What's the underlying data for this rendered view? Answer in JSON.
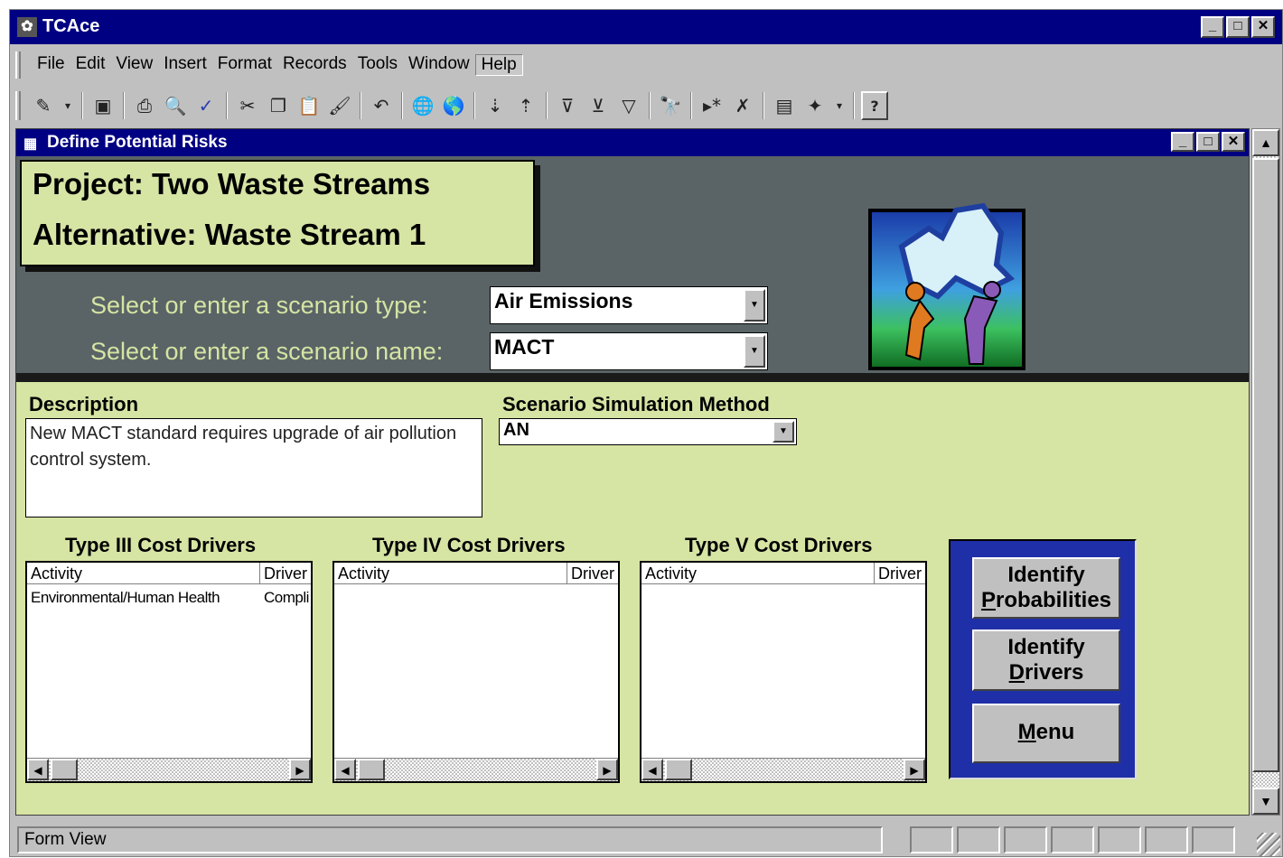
{
  "app": {
    "title": "TCAce",
    "icon": "tcace-app-icon"
  },
  "menu": {
    "items": [
      "File",
      "Edit",
      "View",
      "Insert",
      "Format",
      "Records",
      "Tools",
      "Window",
      "Help"
    ],
    "active": "Help"
  },
  "toolbar": {
    "icons": [
      "design-view-icon",
      "save-icon",
      "print-icon",
      "print-preview-icon",
      "spelling-icon",
      "cut-icon",
      "copy-icon",
      "paste-icon",
      "format-painter-icon",
      "undo-icon",
      "insert-hyperlink-icon",
      "web-toolbar-icon",
      "sort-ascending-icon",
      "sort-descending-icon",
      "filter-by-selection-icon",
      "filter-by-form-icon",
      "apply-filter-icon",
      "find-icon",
      "new-record-icon",
      "delete-record-icon",
      "database-window-icon",
      "new-object-icon",
      "help-icon"
    ]
  },
  "form": {
    "title": "Define Potential Risks",
    "project_line": "Project: Two Waste Streams",
    "alternative_line": "Alternative: Waste Stream 1",
    "scenario_type_label": "Select or enter a scenario type:",
    "scenario_type_value": "Air Emissions",
    "scenario_name_label": "Select or enter a scenario name:",
    "scenario_name_value": "MACT",
    "description_label": "Description",
    "description_value": "New MACT standard requires upgrade of air pollution control system.",
    "simulation_label": "Scenario Simulation Method",
    "simulation_value": "AN"
  },
  "lists": {
    "type3": {
      "title": "Type III Cost Drivers",
      "col_activity": "Activity",
      "col_driver": "Driver",
      "rows": [
        {
          "activity": "Environmental/Human Health",
          "driver": "Compli"
        }
      ]
    },
    "type4": {
      "title": "Type IV Cost Drivers",
      "col_activity": "Activity",
      "col_driver": "Driver",
      "rows": []
    },
    "type5": {
      "title": "Type V Cost Drivers",
      "col_activity": "Activity",
      "col_driver": "Driver",
      "rows": []
    }
  },
  "buttons": {
    "identify_probabilities": {
      "line1": "Identify",
      "line2_ul": "P",
      "line2_rest": "robabilities"
    },
    "identify_drivers": {
      "line1": "Identify",
      "line2_ul": "D",
      "line2_rest": "rivers"
    },
    "menu": {
      "ul": "M",
      "rest": "enu"
    }
  },
  "status": {
    "text": "Form View"
  },
  "colors": {
    "titlebar": "#000082",
    "form_bg": "#d6e4a4",
    "header_bg": "#5a6466",
    "button_panel": "#1f2fa8"
  }
}
